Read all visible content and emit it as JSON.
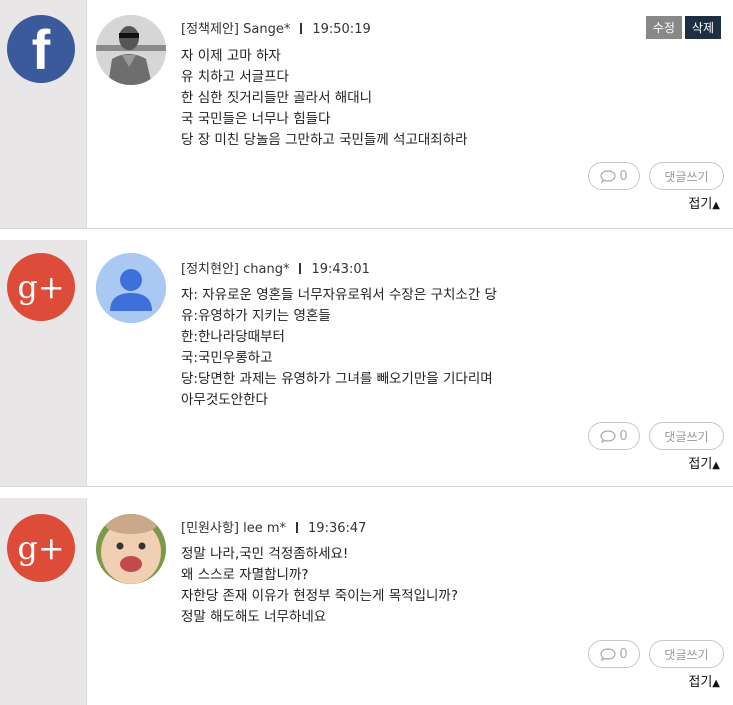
{
  "posts": [
    {
      "platform": "facebook",
      "category": "[정책제안]",
      "author": "Sange*",
      "time": "19:50:19",
      "edit_label": "수정",
      "delete_label": "삭제",
      "lines": [
        "자 이제 고마 하자",
        "유 치하고 서글프다",
        "한 심한 짓거리들만 골라서 해대니",
        "국 국민들은 너무나 힘들다",
        "당 장 미친 당놀음 그만하고 국민들께 석고대죄하라"
      ],
      "comment_count": "0",
      "reply_label": "댓글쓰기",
      "fold_label": "접기"
    },
    {
      "platform": "google-plus",
      "category": "[정치현안]",
      "author": "chang*",
      "time": "19:43:01",
      "lines": [
        "자: 자유로운 영혼들 너무자유로워서 수장은 구치소간 당",
        "유:유영하가 지키는 영혼들",
        "한:한나라당때부터",
        "국:국민우롱하고",
        "당:당면한 과제는 유영하가 그녀를 빼오기만을 기다리며",
        "아무것도안한다"
      ],
      "comment_count": "0",
      "reply_label": "댓글쓰기",
      "fold_label": "접기"
    },
    {
      "platform": "google-plus",
      "category": "[민원사항]",
      "author": "lee m*",
      "time": "19:36:47",
      "lines": [
        "정말 나라,국민 걱정좀하세요!",
        "왜 스스로 자멸합니까?",
        "자한당 존재 이유가 현정부 죽이는게 목적입니까?",
        "정말 해도해도 너무하네요"
      ],
      "comment_count": "0",
      "reply_label": "댓글쓰기",
      "fold_label": "접기"
    }
  ],
  "icons": {
    "facebook": "f",
    "google_plus": "g+"
  },
  "colors": {
    "facebook": "#3b5a9b",
    "google_plus": "#dd4b39",
    "edit": "#888888",
    "delete": "#1e2f44"
  }
}
